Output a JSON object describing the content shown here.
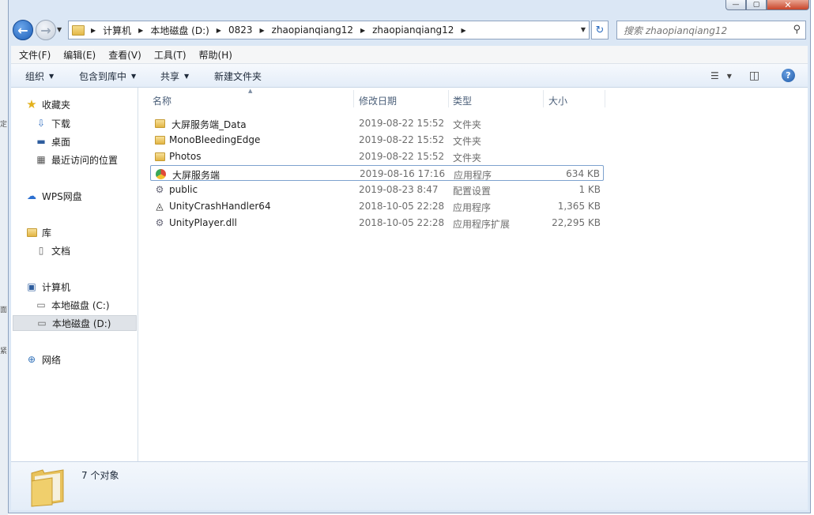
{
  "address": {
    "crumbs": [
      "计算机",
      "本地磁盘 (D:)",
      "0823",
      "zhaopianqiang12",
      "zhaopianqiang12"
    ]
  },
  "search": {
    "placeholder": "搜索 zhaopianqiang12"
  },
  "menu": {
    "items": [
      "文件(F)",
      "编辑(E)",
      "查看(V)",
      "工具(T)",
      "帮助(H)"
    ]
  },
  "toolbar": {
    "organize": "组织",
    "include_library": "包含到库中",
    "share": "共享",
    "new_folder": "新建文件夹"
  },
  "nav": {
    "favorites": "收藏夹",
    "downloads": "下载",
    "desktop": "桌面",
    "recent": "最近访问的位置",
    "wps": "WPS网盘",
    "libraries": "库",
    "documents": "文档",
    "computer": "计算机",
    "drive_c": "本地磁盘 (C:)",
    "drive_d": "本地磁盘 (D:)",
    "network": "网络"
  },
  "columns": {
    "name": "名称",
    "date": "修改日期",
    "type": "类型",
    "size": "大小"
  },
  "files": [
    {
      "name": "大屏服务端_Data",
      "date": "2019-08-22 15:52",
      "type": "文件夹",
      "size": "",
      "icon": "folder-icon"
    },
    {
      "name": "MonoBleedingEdge",
      "date": "2019-08-22 15:52",
      "type": "文件夹",
      "size": "",
      "icon": "folder-icon"
    },
    {
      "name": "Photos",
      "date": "2019-08-22 15:52",
      "type": "文件夹",
      "size": "",
      "icon": "folder-icon"
    },
    {
      "name": "大屏服务端",
      "date": "2019-08-16 17:16",
      "type": "应用程序",
      "size": "634 KB",
      "icon": "app-icon"
    },
    {
      "name": "public",
      "date": "2019-08-23 8:47",
      "type": "配置设置",
      "size": "1 KB",
      "icon": "config-file-icon"
    },
    {
      "name": "UnityCrashHandler64",
      "date": "2018-10-05 22:28",
      "type": "应用程序",
      "size": "1,365 KB",
      "icon": "unity-icon"
    },
    {
      "name": "UnityPlayer.dll",
      "date": "2018-10-05 22:28",
      "type": "应用程序扩展",
      "size": "22,295 KB",
      "icon": "dll-file-icon"
    }
  ],
  "status": {
    "count": "7 个对象"
  }
}
